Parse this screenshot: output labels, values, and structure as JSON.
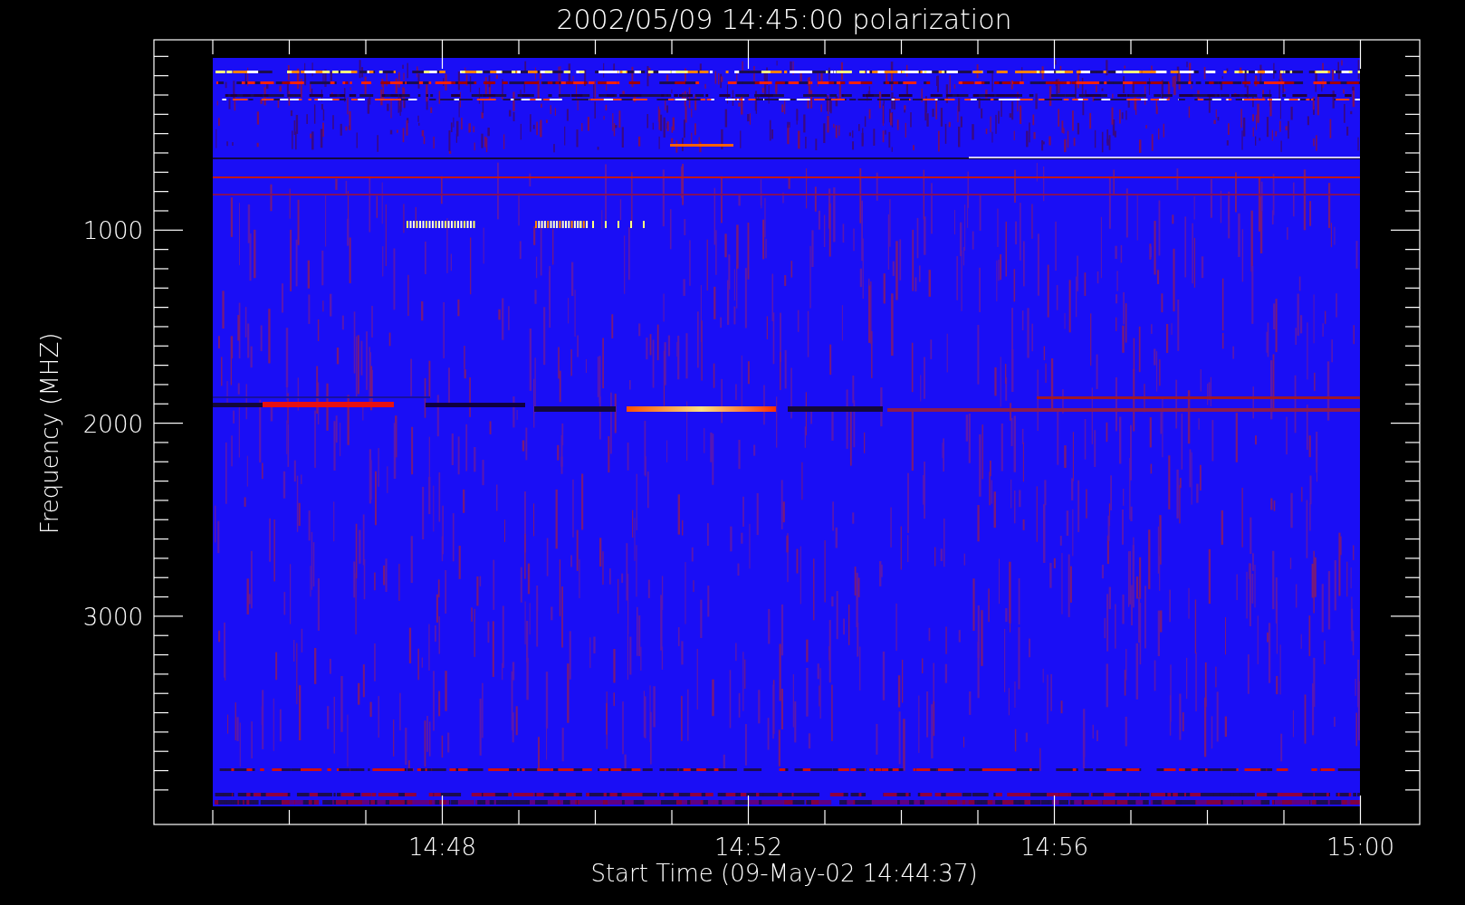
{
  "title": "2002/05/09 14:45:00 polarization",
  "x_axis": {
    "label": "Start Time (09-May-02 14:44:37)",
    "ticks": [
      "14:48",
      "14:52",
      "14:56",
      "15:00"
    ]
  },
  "y_axis": {
    "label": "Frequency (MHZ)",
    "ticks": [
      "1000",
      "2000",
      "3000"
    ]
  }
}
